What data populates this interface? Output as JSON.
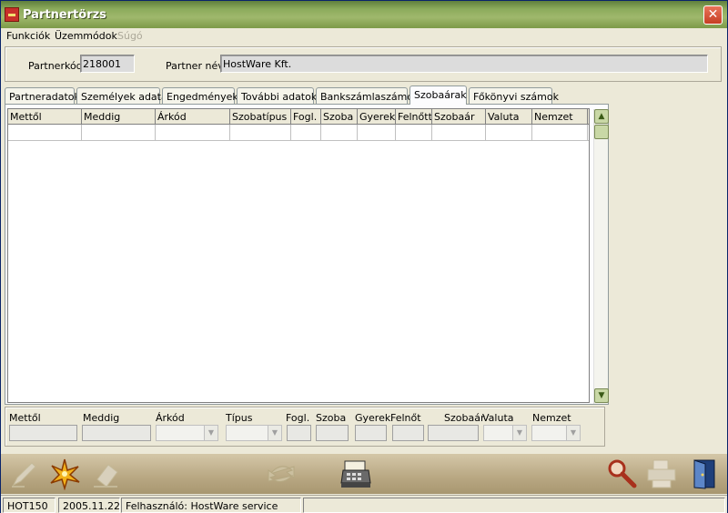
{
  "window": {
    "title": "Partnertörzs",
    "close_glyph": "✕"
  },
  "menu": [
    {
      "label": "Funkciók",
      "enabled": true
    },
    {
      "label": "Üzemmódok",
      "enabled": true
    },
    {
      "label": "Súgó",
      "enabled": false
    }
  ],
  "header": {
    "partner_code_label": "Partnerkód",
    "partner_code_value": "218001",
    "partner_name_label": "Partner név",
    "partner_name_value": "HostWare Kft."
  },
  "tabs": [
    {
      "label": "Partneradatok",
      "active": false
    },
    {
      "label": "Személyek adatai",
      "active": false
    },
    {
      "label": "Engedmények",
      "active": false
    },
    {
      "label": "További adatok",
      "active": false
    },
    {
      "label": "Bankszámlaszámok",
      "active": false
    },
    {
      "label": "Szobaárak",
      "active": true
    },
    {
      "label": "Főkönyvi számok",
      "active": false
    }
  ],
  "grid": {
    "columns": [
      "Mettől",
      "Meddig",
      "Árkód",
      "Szobatípus",
      "Fogl.",
      "Szoba",
      "Gyerek",
      "Felnőtt",
      "Szobaár",
      "Valuta",
      "Nemzet"
    ],
    "rows": [
      [
        "",
        "",
        "",
        "",
        "",
        "",
        "",
        "",
        "",
        "",
        ""
      ]
    ]
  },
  "scrollbar": {
    "up_glyph": "▲",
    "down_glyph": "▼"
  },
  "edit_form": {
    "labels": [
      "Mettől",
      "Meddig",
      "Árkód",
      "Típus",
      "Fogl.",
      "Szoba",
      "Gyerek",
      "Felnőt",
      "Szobaár",
      "Valuta",
      "Nemzet"
    ],
    "combo_glyph": "▼"
  },
  "toolbar": [
    {
      "icon": "edit-pen-icon",
      "enabled": false
    },
    {
      "icon": "new-star-icon",
      "enabled": true
    },
    {
      "icon": "delete-eraser-icon",
      "enabled": false
    },
    {
      "icon": "refresh-arrows-icon",
      "enabled": false
    },
    {
      "icon": "cash-register-icon",
      "enabled": true
    },
    {
      "icon": "search-magnifier-icon",
      "enabled": true
    },
    {
      "icon": "print-icon",
      "enabled": false
    },
    {
      "icon": "exit-door-icon",
      "enabled": true
    }
  ],
  "status": {
    "module": "HOT150",
    "date": "2005.11.22",
    "user": "Felhasználó: HostWare service",
    "extra": ""
  }
}
